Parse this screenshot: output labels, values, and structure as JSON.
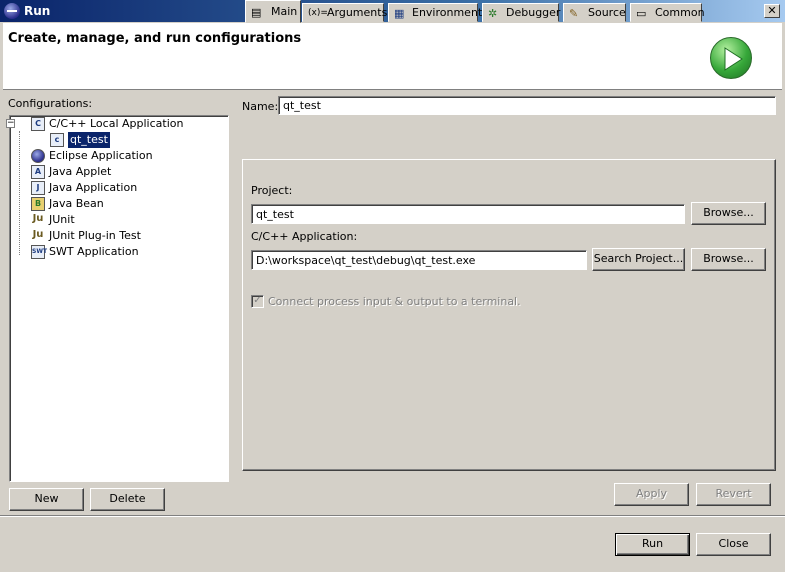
{
  "window": {
    "title": "Run",
    "close_glyph": "✕"
  },
  "header": {
    "heading": "Create, manage, and run configurations"
  },
  "configurations": {
    "label": "Configurations:",
    "items": [
      {
        "label": "C/C++ Local Application",
        "icon": "c-app-icon",
        "glyph": "C"
      },
      {
        "label": "qt_test",
        "icon": "c-config-icon",
        "glyph": "c"
      },
      {
        "label": "Eclipse Application",
        "icon": "eclipse-icon",
        "glyph": ""
      },
      {
        "label": "Java Applet",
        "icon": "java-applet-icon",
        "glyph": "A"
      },
      {
        "label": "Java Application",
        "icon": "java-app-icon",
        "glyph": "J"
      },
      {
        "label": "Java Bean",
        "icon": "java-bean-icon",
        "glyph": "B"
      },
      {
        "label": "JUnit",
        "icon": "junit-icon",
        "glyph": "Ju"
      },
      {
        "label": "JUnit Plug-in Test",
        "icon": "junit-plugin-icon",
        "glyph": "Ju"
      },
      {
        "label": "SWT Application",
        "icon": "swt-icon",
        "glyph": "SWT"
      }
    ],
    "expander_glyph": "−",
    "new_button": "New",
    "delete_button": "Delete"
  },
  "name_field": {
    "label": "Name:",
    "value": "qt_test"
  },
  "tabs": [
    {
      "label": "Main",
      "icon": "main-tab-icon",
      "glyph": "▤"
    },
    {
      "label": "Arguments",
      "icon": "arguments-tab-icon",
      "glyph": "(x)="
    },
    {
      "label": "Environment",
      "icon": "environment-tab-icon",
      "glyph": "▦"
    },
    {
      "label": "Debugger",
      "icon": "debugger-tab-icon",
      "glyph": "✲"
    },
    {
      "label": "Source",
      "icon": "source-tab-icon",
      "glyph": "✎"
    },
    {
      "label": "Common",
      "icon": "common-tab-icon",
      "glyph": "▭"
    }
  ],
  "main_tab": {
    "project_label": "Project:",
    "project_value": "qt_test",
    "project_browse": "Browse...",
    "app_label": "C/C++ Application:",
    "app_value": "D:\\workspace\\qt_test\\debug\\qt_test.exe",
    "search_project": "Search Project...",
    "app_browse": "Browse...",
    "connect_label": "Connect process input & output to a terminal.",
    "connect_checked": true,
    "check_glyph": "✓"
  },
  "footer": {
    "apply": "Apply",
    "revert": "Revert",
    "run": "Run",
    "close": "Close"
  },
  "colors": {
    "title_bar": "#0a246a",
    "face": "#d4d0c8",
    "selection": "#0a246a",
    "run_logo": "#37a83a"
  }
}
